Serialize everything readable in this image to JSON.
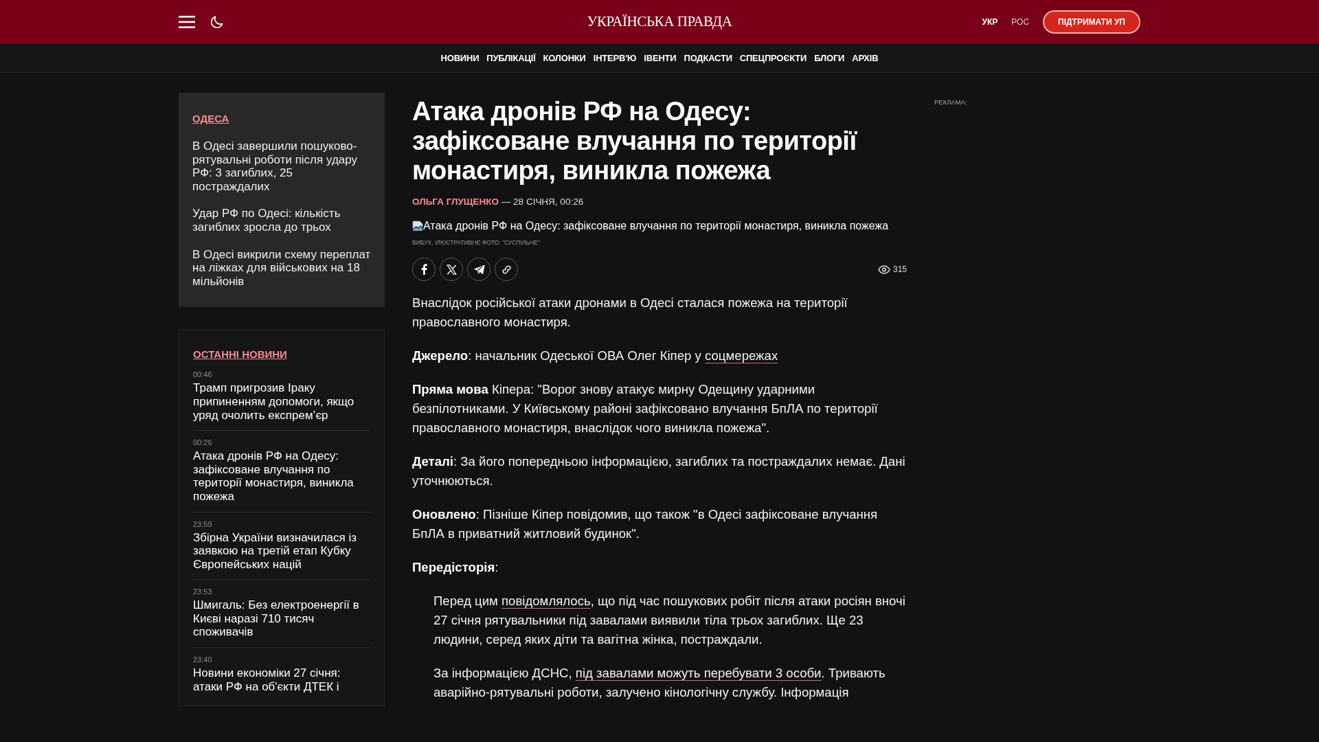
{
  "header": {
    "logo": "УКРАЇНСЬКА ПРАВДА",
    "languages": [
      {
        "label": "УКР",
        "selected": true
      },
      {
        "label": "РОС",
        "selected": false
      }
    ],
    "support_button": "ПІДТРИМАТИ УП"
  },
  "nav": [
    "НОВИНИ",
    "ПУБЛІКАЦІЇ",
    "КОЛОНКИ",
    "ІНТЕРВ'Ю",
    "ІВЕНТИ",
    "ПОДКАСТИ",
    "СПЕЦПРОЄКТИ",
    "БЛОГИ",
    "АРХІВ"
  ],
  "sidebar": {
    "region": {
      "title": "ОДЕСА",
      "items": [
        "В Одесі завершили пошуково-рятувальні роботи після удару РФ: 3 загиблих, 25 постраждалих",
        "Удар РФ по Одесі: кількість загиблих зросла до трьох",
        "В Одесі викрили схему переплат на ліжках для військових на 18 мільйонів"
      ]
    },
    "latest_news": {
      "title": "ОСТАННІ НОВИНИ",
      "items": [
        {
          "time": "00:46",
          "title": "Трамп пригрозив Іраку припиненням допомоги, якщо уряд очолить експрем’єр"
        },
        {
          "time": "00:26",
          "title": "Атака дронів РФ на Одесу: зафіксоване влучання по території монастиря, виникла пожежа"
        },
        {
          "time": "23:59",
          "title": "Збірна України визначилася із заявкою на третій етап Кубку Європейських націй"
        },
        {
          "time": "23:53",
          "title": "Шмигаль: Без електроенергії в Києві наразі 710 тисяч споживачів"
        },
        {
          "time": "23:40",
          "title": "Новини економіки 27 січня: атаки РФ на об'єкти ДТЕК і"
        }
      ]
    }
  },
  "article": {
    "title": "Атака дронів РФ на Одесу: зафіксоване влучання по території монастиря, виникла пожежа",
    "author": "ОЛЬГА ГЛУЩЕНКО",
    "date": "— 28 СІЧНЯ, 00:26",
    "image_alt": "Атака дронів РФ на Одесу: зафіксоване влучання по території монастиря, виникла пожежа",
    "caption": "ВИБУХ, ІЛЮСТРАТИВНЕ ФОТО: \"СУСПІЛЬНЕ\"",
    "views": "315",
    "body": [
      {
        "kind": "paragraph",
        "parts": [
          {
            "kind": "text",
            "text": "Внаслідок російської атаки дронами в Одесі сталася пожежа на території православного монастиря."
          }
        ]
      },
      {
        "kind": "paragraph",
        "parts": [
          {
            "kind": "bold",
            "text": "Джерело"
          },
          {
            "kind": "text",
            "text": ": начальник Одеської ОВА Олег Кіпер у "
          },
          {
            "kind": "link",
            "text": "соцмережах"
          }
        ]
      },
      {
        "kind": "paragraph",
        "parts": [
          {
            "kind": "bold",
            "text": "Пряма мова"
          },
          {
            "kind": "text",
            "text": " Кіпера: \"Ворог знову атакує мирну Одещину ударними безпілотниками. У Київському районі зафіксовано влучання БпЛА по території православного монастиря, внаслідок чого виникла пожежа\"."
          }
        ]
      },
      {
        "kind": "paragraph",
        "parts": [
          {
            "kind": "bold",
            "text": "Деталі"
          },
          {
            "kind": "text",
            "text": ": За його попередньою інформацією, загиблих та постраждалих немає. Дані уточнюються."
          }
        ]
      },
      {
        "kind": "paragraph",
        "parts": [
          {
            "kind": "bold",
            "text": "Оновлено"
          },
          {
            "kind": "text",
            "text": ": Пізніше Кіпер повідомив, що також \"в Одесі зафіксоване влучання БпЛА в приватний житловий будинок\"."
          }
        ]
      },
      {
        "kind": "paragraph",
        "parts": [
          {
            "kind": "bold",
            "text": "Передісторія"
          },
          {
            "kind": "text",
            "text": ":"
          }
        ]
      },
      {
        "kind": "quote",
        "parts": [
          {
            "kind": "text",
            "text": "Перед цим "
          },
          {
            "kind": "link",
            "text": "повідомлялось"
          },
          {
            "kind": "text",
            "text": ", що під час пошукових робіт після атаки росіян вночі 27 січня рятувальники під завалами виявили тіла трьох загиблих. Ще 23 людини, серед яких діти та вагітна жінка, постраждали."
          }
        ]
      },
      {
        "kind": "quote",
        "parts": [
          {
            "kind": "text",
            "text": "За інформацією ДСНС, "
          },
          {
            "kind": "link",
            "text": "під завалами можуть перебувати 3 особи"
          },
          {
            "kind": "text",
            "text": ". Тривають аварійно-рятувальні роботи, залучено кінологічну службу. Інформація"
          }
        ]
      }
    ]
  },
  "ad": {
    "label": "РЕКЛАМА:"
  }
}
